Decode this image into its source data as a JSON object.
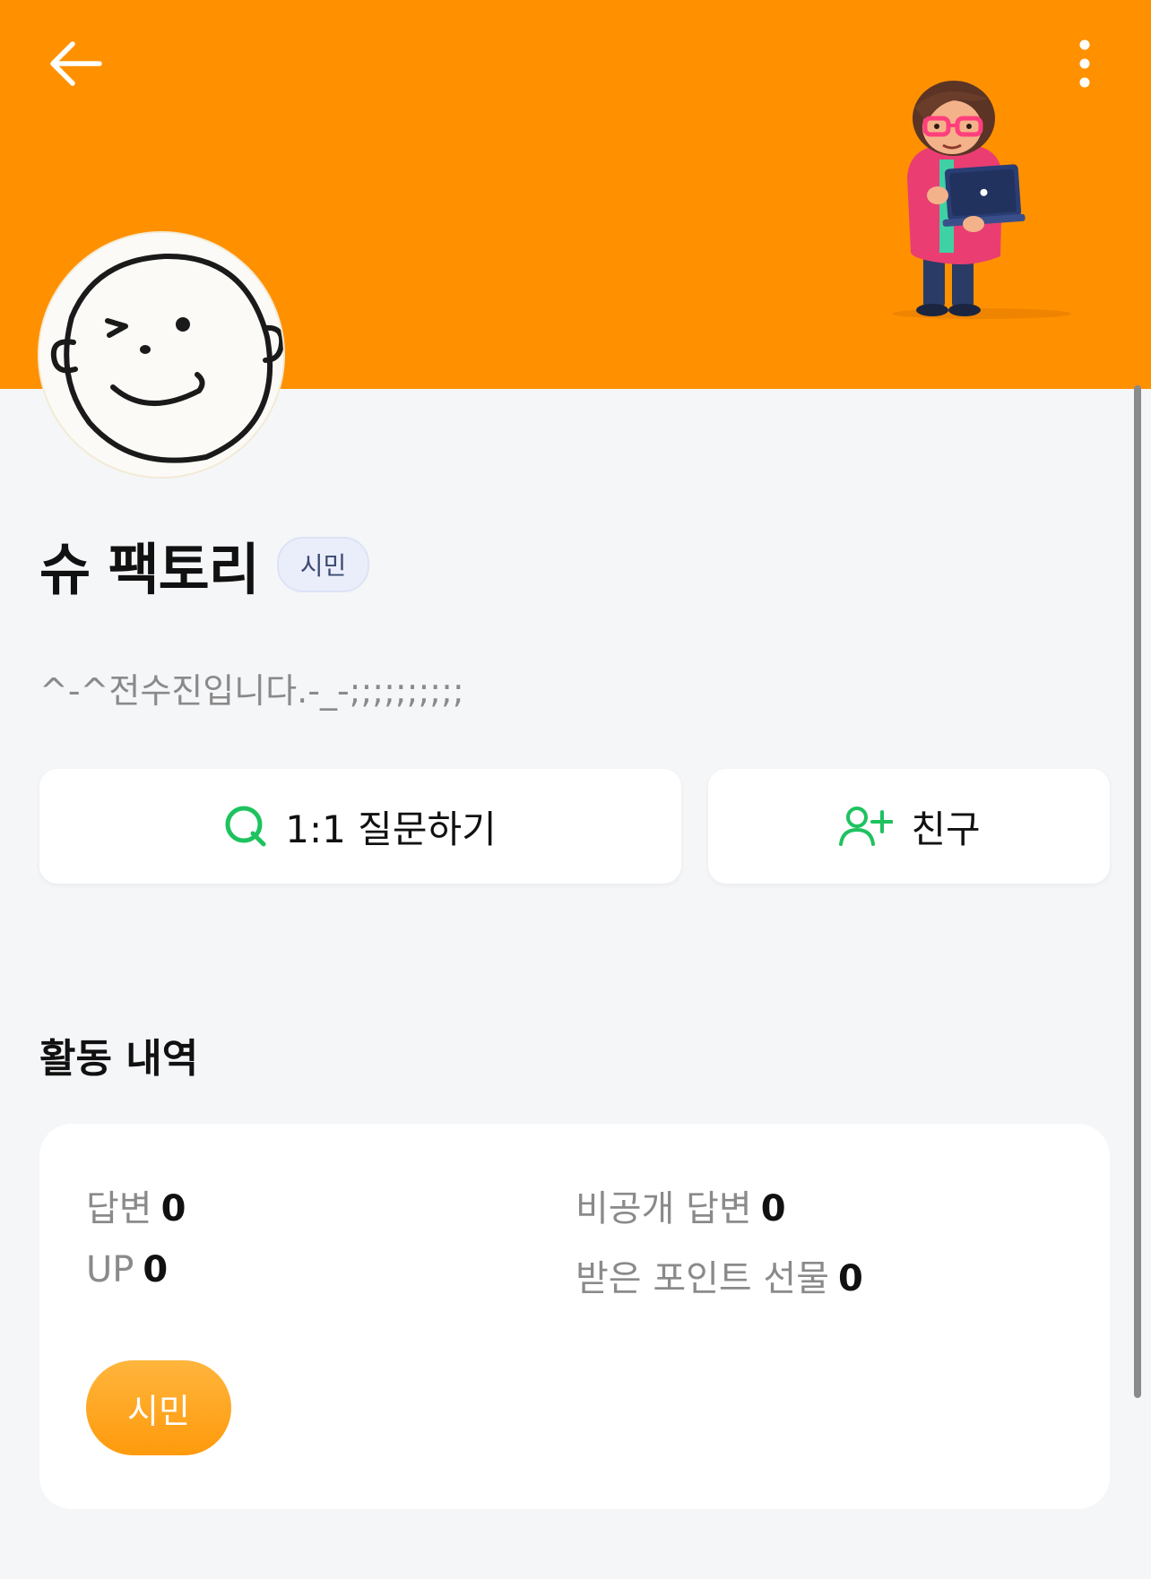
{
  "header": {
    "bg_color": "#ff9100",
    "back_icon": "arrow-left-icon",
    "more_icon": "more-vertical-icon"
  },
  "profile": {
    "name": "슈 팩토리",
    "grade": "시민",
    "bio": "^-^전수진입니다.-_-;;;;;;;;;;"
  },
  "actions": {
    "question_icon": "q-question-icon",
    "question_label": "1:1 질문하기",
    "friend_icon": "add-friend-icon",
    "friend_label": "친구",
    "accent_color": "#1ec25f"
  },
  "activity": {
    "title": "활동 내역",
    "stats": [
      {
        "label": "답변",
        "value": "0"
      },
      {
        "label": "비공개 답변",
        "value": "0"
      },
      {
        "label": "UP",
        "value": "0"
      },
      {
        "label": "받은 포인트 선물",
        "value": "0"
      }
    ],
    "grade_pill": "시민"
  }
}
